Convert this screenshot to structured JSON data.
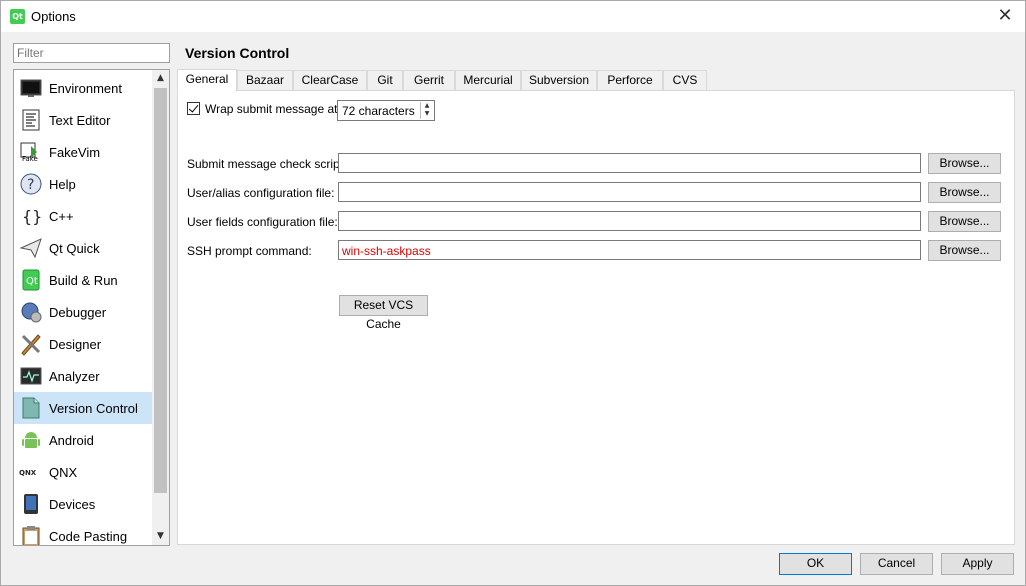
{
  "window": {
    "title": "Options",
    "app_icon": "qt-logo-icon"
  },
  "sidebar": {
    "filter_placeholder": "Filter",
    "items": [
      {
        "label": "Environment",
        "icon": "monitor-icon"
      },
      {
        "label": "Text Editor",
        "icon": "text-document-icon"
      },
      {
        "label": "FakeVim",
        "icon": "fakevim-icon"
      },
      {
        "label": "Help",
        "icon": "help-icon"
      },
      {
        "label": "C++",
        "icon": "braces-icon"
      },
      {
        "label": "Qt Quick",
        "icon": "paper-plane-icon"
      },
      {
        "label": "Build & Run",
        "icon": "build-run-icon"
      },
      {
        "label": "Debugger",
        "icon": "bug-icon"
      },
      {
        "label": "Designer",
        "icon": "pen-ruler-icon"
      },
      {
        "label": "Analyzer",
        "icon": "oscilloscope-icon"
      },
      {
        "label": "Version Control",
        "icon": "version-control-icon"
      },
      {
        "label": "Android",
        "icon": "android-icon"
      },
      {
        "label": "QNX",
        "icon": "qnx-logo-icon"
      },
      {
        "label": "Devices",
        "icon": "device-icon"
      },
      {
        "label": "Code Pasting",
        "icon": "clipboard-icon"
      }
    ],
    "selected": "Version Control"
  },
  "page": {
    "title": "Version Control",
    "tabs": [
      "General",
      "Bazaar",
      "ClearCase",
      "Git",
      "Gerrit",
      "Mercurial",
      "Subversion",
      "Perforce",
      "CVS"
    ],
    "active_tab": "General",
    "wrap": {
      "label": "Wrap submit message at:",
      "checked": true,
      "value": "72 characters"
    },
    "fields": [
      {
        "label": "Submit message check script:",
        "value": "",
        "browse": "Browse..."
      },
      {
        "label": "User/alias configuration file:",
        "value": "",
        "browse": "Browse..."
      },
      {
        "label": "User fields configuration file:",
        "value": "",
        "browse": "Browse..."
      },
      {
        "label": "SSH prompt command:",
        "value": "win-ssh-askpass",
        "browse": "Browse..."
      }
    ],
    "reset_button": "Reset VCS Cache"
  },
  "footer": {
    "ok": "OK",
    "cancel": "Cancel",
    "apply": "Apply"
  },
  "colors": {
    "selection": "#cce4f7",
    "error_text": "#e00000",
    "accent": "#0078d7"
  }
}
